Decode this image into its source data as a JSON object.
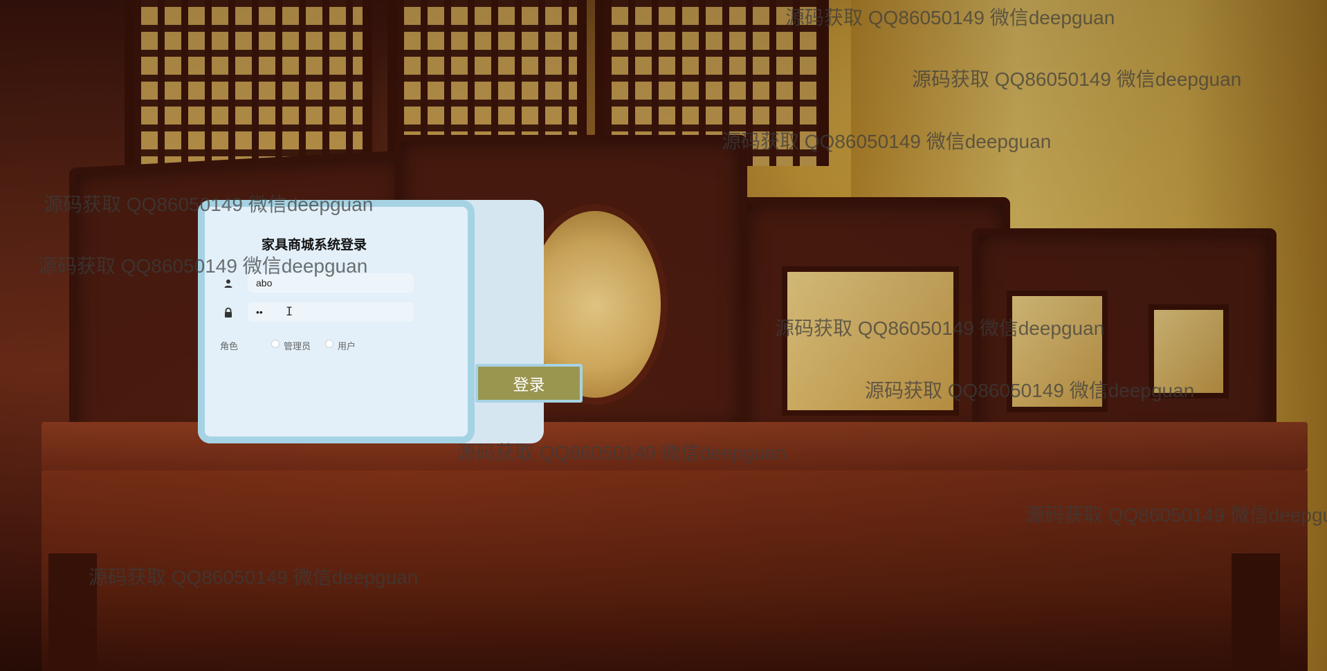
{
  "login": {
    "title": "家具商城系统登录",
    "username_value": "abo",
    "password_value": "••",
    "role_label": "角色",
    "role_options": [
      "管理员",
      "用户"
    ],
    "submit_label": "登录"
  },
  "icons": {
    "username": "user-icon",
    "password": "lock-icon",
    "cursor": "text-cursor-icon"
  },
  "colors": {
    "panel_bg": "#e3f0f9",
    "panel_border": "#a6d3e3",
    "button_bg": "#9a9650",
    "button_text": "#ffffff"
  },
  "watermark_text": "源码获取 QQ86050149 微信deepguan"
}
